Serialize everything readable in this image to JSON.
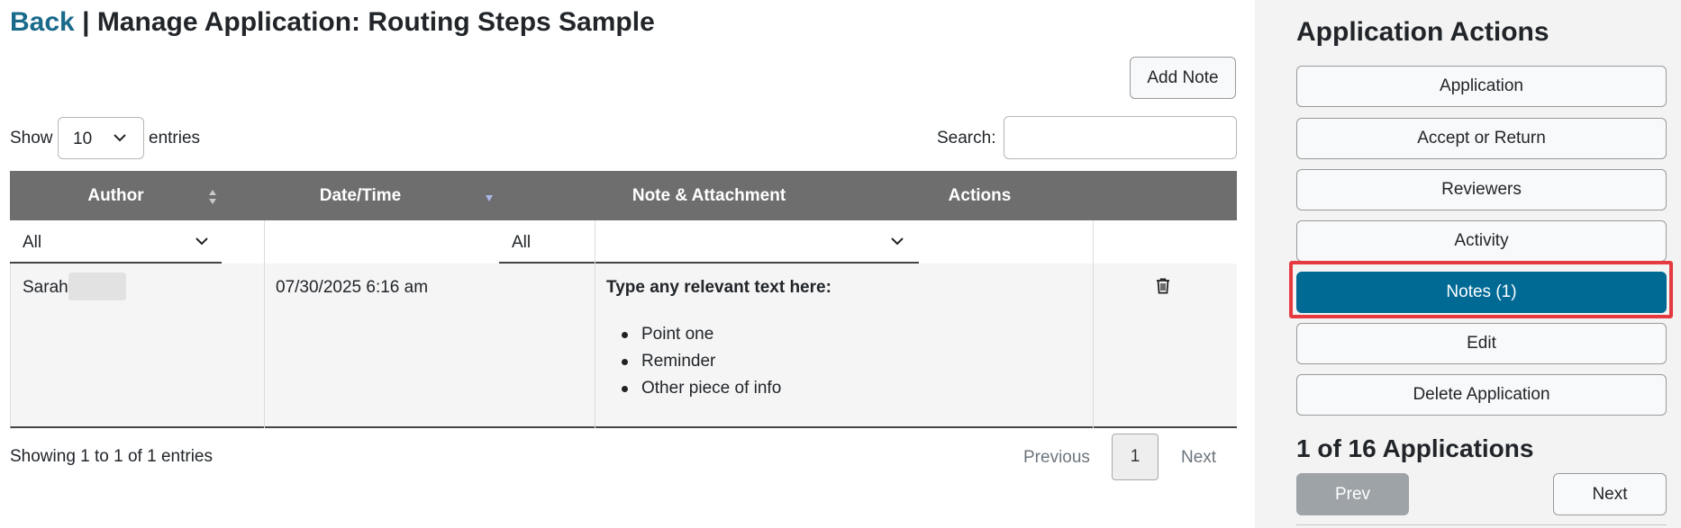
{
  "header": {
    "back_label": "Back",
    "separator": "|",
    "title": "Manage Application: Routing Steps Sample"
  },
  "toolbar": {
    "add_note_label": "Add Note"
  },
  "table_controls": {
    "show_label": "Show",
    "entries_value": "10",
    "entries_label": "entries",
    "search_label": "Search:",
    "search_value": ""
  },
  "table": {
    "columns": [
      "Author",
      "Date/Time",
      "Note & Attachment",
      "Actions"
    ],
    "filters": {
      "author": "All",
      "note": "All"
    },
    "rows": [
      {
        "author": "Sarah",
        "datetime": "07/30/2025 6:16 am",
        "note_title": "Type any relevant text here:",
        "note_points": [
          "Point one",
          "Reminder",
          "Other piece of info"
        ],
        "action_icon": "trash-icon"
      }
    ]
  },
  "footer": {
    "showing": "Showing 1 to 1 of 1 entries",
    "previous": "Previous",
    "page": "1",
    "next": "Next"
  },
  "sidebar": {
    "title": "Application Actions",
    "buttons": [
      "Application",
      "Accept or Return",
      "Reviewers",
      "Activity",
      "Notes (1)",
      "Edit",
      "Delete Application"
    ],
    "active_button": "Notes (1)",
    "count": "1 of 16 Applications",
    "prev": "Prev",
    "next": "Next"
  },
  "colors": {
    "accent": "#006a95",
    "link": "#1a6a8c",
    "table_header": "#6e6e6e",
    "highlight": "#e53a3f"
  }
}
